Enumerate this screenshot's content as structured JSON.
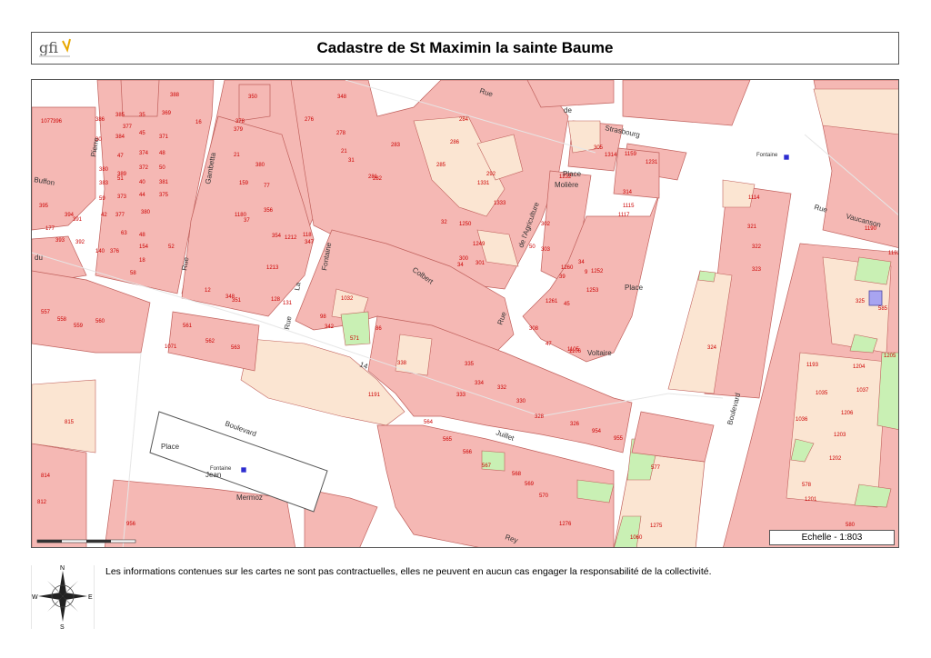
{
  "header": {
    "logo_text": "gfi",
    "title": "Cadastre de St Maximin la sainte Baume"
  },
  "colors": {
    "parcel": "#f5b8b4",
    "parcel_stroke": "#c0605c",
    "courtyard": "#fbe5d2",
    "garden": "#c9f0b4",
    "road": "#ffffff",
    "pool": "#a8a4f0",
    "number": "#cc0000"
  },
  "map": {
    "streets": [
      {
        "label": "Rue",
        "name": "rue-label"
      },
      {
        "label": "de",
        "name": "de-label"
      },
      {
        "label": "Strasbourg",
        "name": "strasbourg-label"
      },
      {
        "label": "Pierre",
        "name": "pierre-label"
      },
      {
        "label": "Gambetta",
        "name": "gambetta-label"
      },
      {
        "label": "Buffon",
        "name": "buffon-label"
      },
      {
        "label": "Rue",
        "name": "rue-gambetta-label"
      },
      {
        "label": "La",
        "name": "la-label"
      },
      {
        "label": "Fontaine",
        "name": "fontaine-street-label"
      },
      {
        "label": "Rue",
        "name": "rue-fontaine-label"
      },
      {
        "label": "Colbert",
        "name": "colbert-label"
      },
      {
        "label": "Rue",
        "name": "rue-agriculture-label"
      },
      {
        "label": "de l'Agriculture",
        "name": "agriculture-label"
      },
      {
        "label": "Place",
        "name": "place-moliere-label-1"
      },
      {
        "label": "Molière",
        "name": "moliere-label"
      },
      {
        "label": "Place",
        "name": "place-label"
      },
      {
        "label": "Voltaire",
        "name": "voltaire-label"
      },
      {
        "label": "Rue",
        "name": "rue-vaucanson-label"
      },
      {
        "label": "Vaucanson",
        "name": "vaucanson-label"
      },
      {
        "label": "Boulevard",
        "name": "boulevard-east-label"
      },
      {
        "label": "14",
        "name": "quatorze-label"
      },
      {
        "label": "Juillet",
        "name": "juillet-label"
      },
      {
        "label": "Boulevard",
        "name": "boulevard-label"
      },
      {
        "label": "Place",
        "name": "place-jean-label"
      },
      {
        "label": "Jean",
        "name": "jean-label"
      },
      {
        "label": "Mermoz",
        "name": "mermoz-label"
      },
      {
        "label": "Rey",
        "name": "rey-label"
      },
      {
        "label": "du",
        "name": "du-label"
      },
      {
        "label": "Fontaine",
        "name": "fontaine-poi-label-1"
      },
      {
        "label": "Fontaine",
        "name": "fontaine-poi-label-2"
      }
    ],
    "parcel_numbers": [
      "388",
      "385",
      "35",
      "369",
      "16",
      "377",
      "386",
      "384",
      "45",
      "371",
      "30",
      "47",
      "374",
      "48",
      "380",
      "389",
      "372",
      "50",
      "383",
      "51",
      "40",
      "381",
      "59",
      "373",
      "44",
      "375",
      "42",
      "377",
      "380",
      "63",
      "48",
      "376",
      "154",
      "52",
      "18",
      "58",
      "140",
      "378",
      "379",
      "21",
      "380",
      "159",
      "77",
      "1180",
      "37",
      "356",
      "354",
      "1212",
      "1213",
      "118",
      "347",
      "12",
      "348",
      "351",
      "128",
      "350",
      "348",
      "276",
      "278",
      "21",
      "31",
      "281",
      "282",
      "283",
      "284",
      "286",
      "285",
      "292",
      "1331",
      "1333",
      "32",
      "1250",
      "1249",
      "300",
      "34",
      "301",
      "302",
      "50",
      "303",
      "34",
      "39",
      "1260",
      "9",
      "1252",
      "1261",
      "45",
      "1253",
      "308",
      "47",
      "1105",
      "1106",
      "305",
      "1314",
      "1159",
      "1231",
      "1232",
      "314",
      "1115",
      "1117",
      "1114",
      "321",
      "322",
      "323",
      "324",
      "325",
      "585",
      "1193",
      "1035",
      "1036",
      "1037",
      "1204",
      "1205",
      "1206",
      "1203",
      "1202",
      "1201",
      "578",
      "580",
      "577",
      "1275",
      "1276",
      "1060",
      "1191",
      "564",
      "565",
      "566",
      "567",
      "568",
      "569",
      "570",
      "571",
      "338",
      "335",
      "333",
      "334",
      "332",
      "330",
      "328",
      "326",
      "954",
      "955",
      "561",
      "562",
      "563",
      "1071",
      "815",
      "814",
      "812",
      "956",
      "557",
      "558",
      "559",
      "560",
      "1077",
      "396",
      "394",
      "177",
      "393",
      "395",
      "391",
      "392",
      "1032",
      "342",
      "86",
      "98",
      "131",
      "1190",
      "1192"
    ],
    "fontaine_markers": 2
  },
  "scale": {
    "text": "Echelle - 1:803"
  },
  "footer": {
    "disclaimer": "Les informations contenues sur les cartes ne sont pas contractuelles, elles ne peuvent en aucun cas engager la responsabilité de la collectivité.",
    "compass": {
      "n": "N",
      "s": "S",
      "e": "E",
      "w": "W"
    }
  }
}
